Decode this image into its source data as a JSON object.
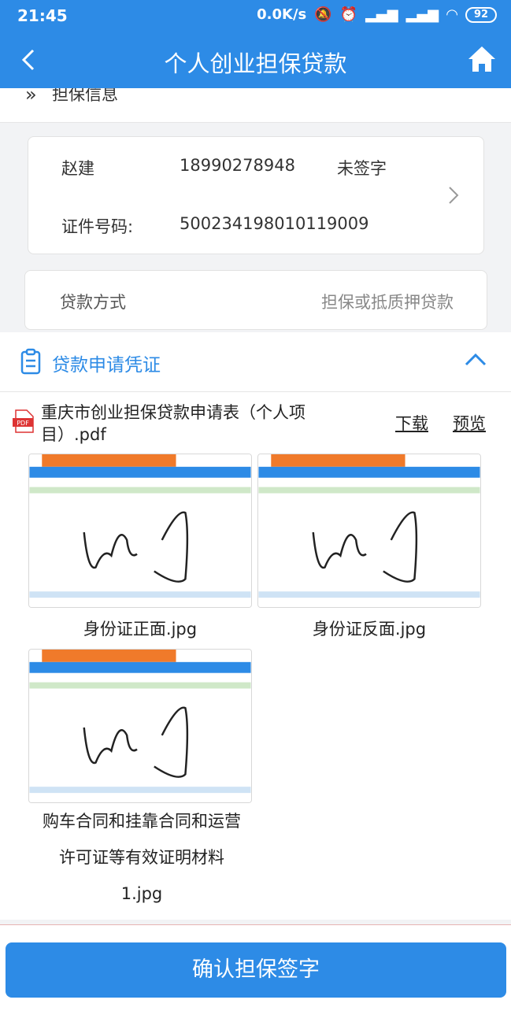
{
  "status": {
    "time": "21:45",
    "network_speed": "0.0K/s",
    "battery": "92"
  },
  "header": {
    "title": "个人创业担保贷款"
  },
  "guarantee_section": {
    "label": "担保信息"
  },
  "guarantor": {
    "name": "赵建",
    "phone": "18990278948",
    "sign_status": "未签字",
    "id_label": "证件号码:",
    "id_number": "500234198010119009"
  },
  "loan_method": {
    "label": "贷款方式",
    "value": "担保或抵质押贷款"
  },
  "proof": {
    "title": "贷款申请凭证",
    "pdf": {
      "name": "重庆市创业担保贷款申请表（个人项目）.pdf",
      "download": "下载",
      "preview": "预览"
    },
    "images": [
      {
        "caption": "身份证正面.jpg"
      },
      {
        "caption": "身份证反面.jpg"
      },
      {
        "caption_line1": "购车合同和挂靠合同和运营",
        "caption_line2": "许可证等有效证明材料",
        "caption_line3": "1.jpg"
      }
    ]
  },
  "footer": {
    "confirm_label": "确认担保签字"
  },
  "colors": {
    "primary": "#2d8be6",
    "orange": "#f07a2a"
  }
}
